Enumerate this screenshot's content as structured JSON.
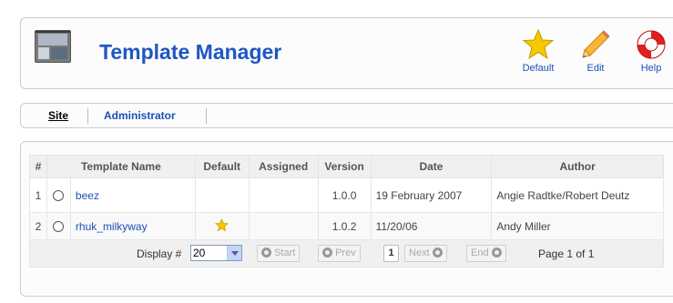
{
  "header": {
    "title": "Template Manager",
    "buttons": {
      "default": "Default",
      "edit": "Edit",
      "help": "Help"
    }
  },
  "submenu": {
    "site": "Site",
    "administrator": "Administrator"
  },
  "table": {
    "columns": [
      "#",
      "Template Name",
      "Default",
      "Assigned",
      "Version",
      "Date",
      "Author"
    ],
    "rows": [
      {
        "num": "1",
        "name": "beez",
        "default": false,
        "assigned": "",
        "version": "1.0.0",
        "date": "19 February 2007",
        "author": "Angie Radtke/Robert Deutz"
      },
      {
        "num": "2",
        "name": "rhuk_milkyway",
        "default": true,
        "assigned": "",
        "version": "1.0.2",
        "date": "11/20/06",
        "author": "Andy Miller"
      }
    ]
  },
  "pagination": {
    "display_label": "Display #",
    "limit": "20",
    "start": "Start",
    "prev": "Prev",
    "current_page": "1",
    "next": "Next",
    "end": "End",
    "page_info": "Page 1 of 1"
  },
  "colors": {
    "accent": "#1f56c4",
    "link": "#1a4fb8",
    "star": "#f5c800"
  },
  "icons": {
    "default": "star-icon",
    "edit": "pencil-icon",
    "help": "lifebuoy-icon",
    "title": "template-manager-icon"
  }
}
